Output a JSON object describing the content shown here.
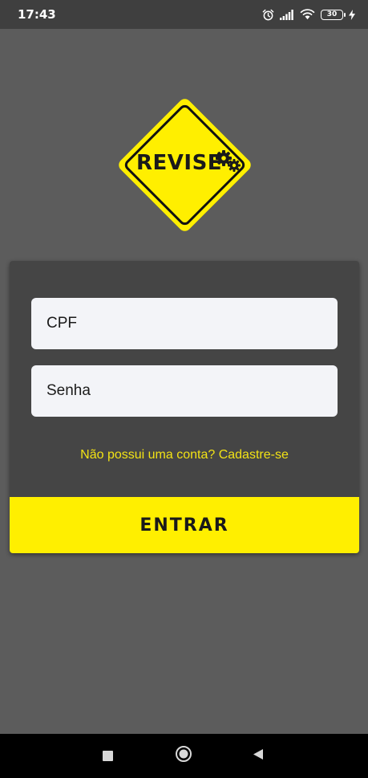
{
  "status_bar": {
    "time": "17:43",
    "battery_level": "30",
    "icons": [
      "alarm-icon",
      "signal-icon",
      "wifi-icon",
      "battery-icon",
      "charging-icon"
    ]
  },
  "logo": {
    "text": "REVISE",
    "icon": "gears-icon",
    "colors": {
      "fill": "#ffef00",
      "border": "#111111"
    }
  },
  "login_form": {
    "cpf_placeholder": "CPF",
    "password_placeholder": "Senha",
    "signup_link": "Não possui uma conta? Cadastre-se",
    "submit_label": "ENTRAR"
  },
  "nav_bar": {
    "buttons": [
      "recents-button",
      "home-button",
      "back-button"
    ]
  },
  "colors": {
    "background": "#5c5c5c",
    "card": "#454545",
    "accent": "#ffef00",
    "link": "#f2e215",
    "input_bg": "#f3f4f8"
  }
}
